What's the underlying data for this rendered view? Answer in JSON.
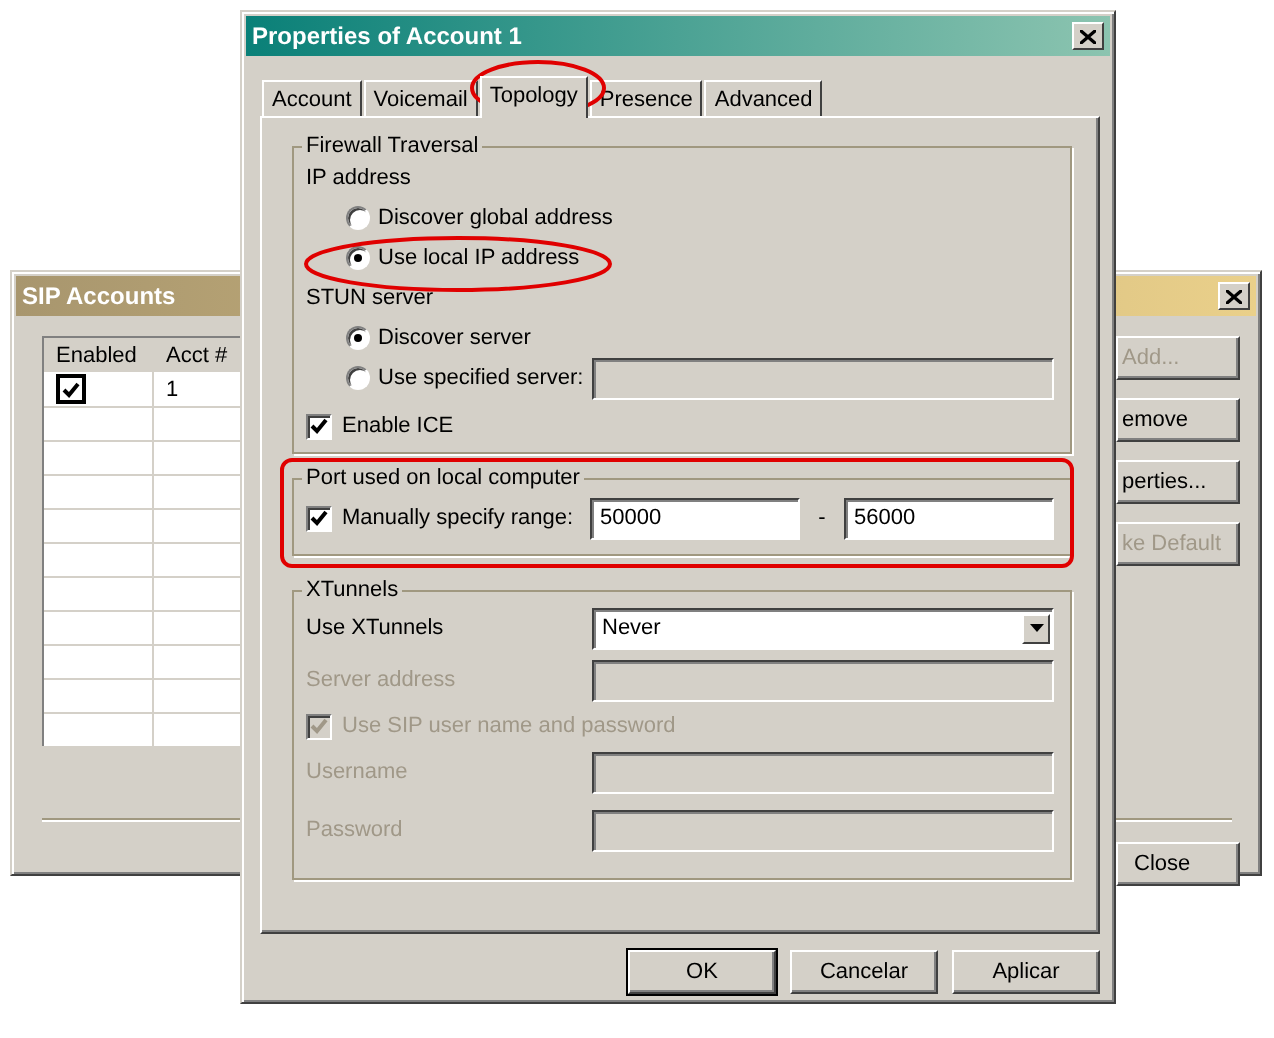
{
  "back_window": {
    "title": "SIP Accounts",
    "table": {
      "columns": [
        "Enabled",
        "Acct #"
      ],
      "rows": [
        {
          "enabled": true,
          "acct": "1"
        }
      ]
    },
    "buttons": [
      {
        "label": "Add...",
        "disabled": true
      },
      {
        "label": "emove",
        "disabled": false
      },
      {
        "label": "perties...",
        "disabled": false
      },
      {
        "label": "ke Default",
        "disabled": true
      }
    ],
    "close_button": "Close"
  },
  "dialog": {
    "title": "Properties of Account 1",
    "tabs": [
      {
        "label": "Account",
        "selected": false
      },
      {
        "label": "Voicemail",
        "selected": false
      },
      {
        "label": "Topology",
        "selected": true
      },
      {
        "label": "Presence",
        "selected": false
      },
      {
        "label": "Advanced",
        "selected": false
      }
    ],
    "firewall": {
      "title": "Firewall Traversal",
      "ip_label": "IP address",
      "ip_options": [
        {
          "label": "Discover global address",
          "selected": false
        },
        {
          "label": "Use local IP address",
          "selected": true
        }
      ],
      "stun_label": "STUN server",
      "stun_options": [
        {
          "label": "Discover server",
          "selected": true
        },
        {
          "label": "Use specified server:",
          "selected": false
        }
      ],
      "enable_ice": {
        "label": "Enable ICE",
        "checked": true
      }
    },
    "port": {
      "title": "Port used on local computer",
      "manual": {
        "label": "Manually specify range:",
        "checked": true
      },
      "from": "50000",
      "separator": "-",
      "to": "56000"
    },
    "xtunnels": {
      "title": "XTunnels",
      "use_label": "Use XTunnels",
      "use_value": "Never",
      "disabled": true,
      "server_label": "Server address",
      "use_sip": {
        "label": "Use SIP user name and password",
        "checked": true
      },
      "username_label": "Username",
      "password_label": "Password"
    },
    "buttons": [
      "OK",
      "Cancelar",
      "Aplicar"
    ]
  }
}
